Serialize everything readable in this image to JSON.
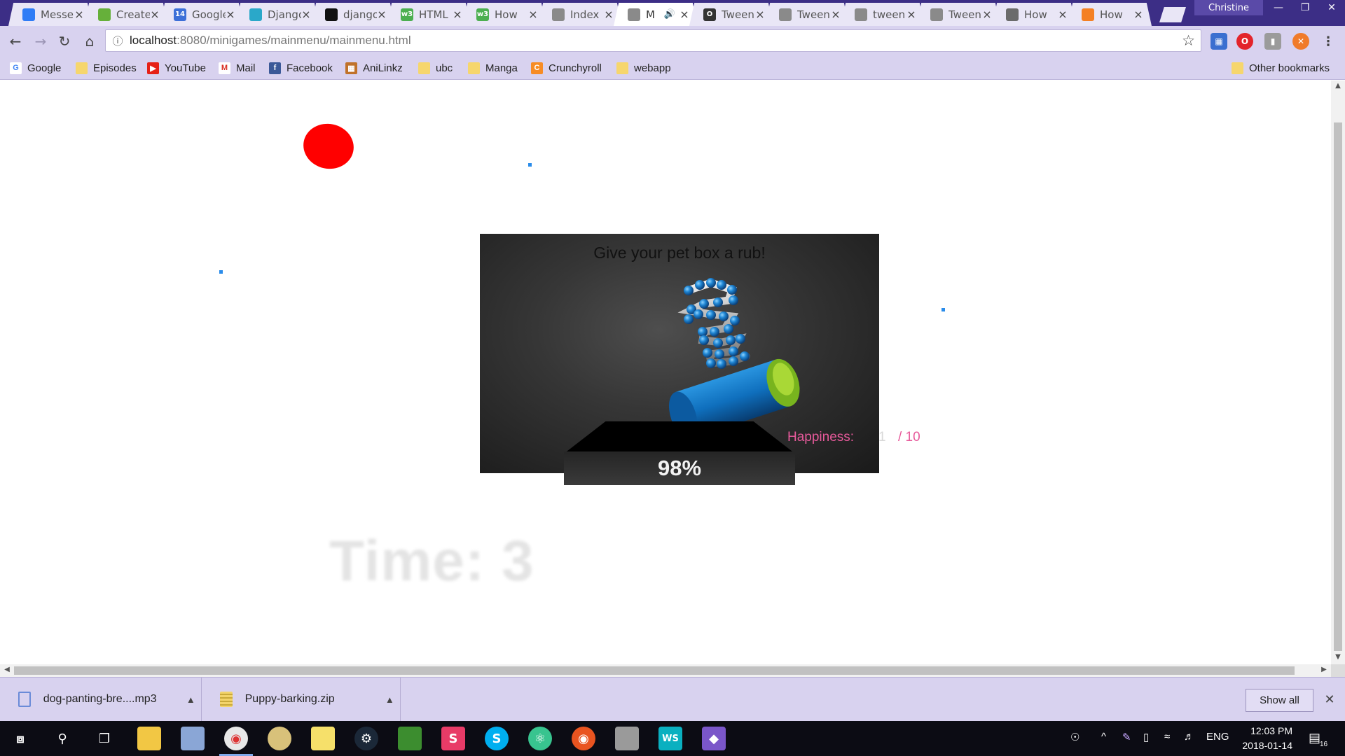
{
  "browser": {
    "profile_name": "Christine",
    "tabs": [
      {
        "title": "Messenger",
        "favicon": "messenger-icon",
        "color": "#2f7cf6"
      },
      {
        "title": "Create",
        "favicon": "leaf-icon",
        "color": "#66b03a"
      },
      {
        "title": "Google Calendar",
        "favicon": "calendar-icon",
        "color": "#3c6fd8",
        "favicon_text": "14"
      },
      {
        "title": "Django",
        "favicon": "django-icon",
        "color": "#2aa8c9"
      },
      {
        "title": "django",
        "favicon": "github-icon",
        "color": "#111111"
      },
      {
        "title": "HTML",
        "favicon": "w3schools-icon",
        "color": "#4caf50",
        "favicon_text": "w3"
      },
      {
        "title": "How",
        "favicon": "w3schools-icon",
        "color": "#4caf50",
        "favicon_text": "w3"
      },
      {
        "title": "Index",
        "favicon": "page-icon",
        "color": "#8a8a8a"
      },
      {
        "title": "M",
        "favicon": "page-icon",
        "color": "#8a8a8a",
        "active": true,
        "audio": true
      },
      {
        "title": "Tween",
        "favicon": "o-icon",
        "color": "#333333",
        "favicon_text": "O"
      },
      {
        "title": "Tween",
        "favicon": "page-icon",
        "color": "#8a8a8a"
      },
      {
        "title": "tween",
        "favicon": "page-icon",
        "color": "#8a8a8a"
      },
      {
        "title": "Tween",
        "favicon": "page-icon",
        "color": "#8a8a8a"
      },
      {
        "title": "How",
        "favicon": "atom-icon",
        "color": "#6b6b6b"
      },
      {
        "title": "How",
        "favicon": "stackoverflow-icon",
        "color": "#f48024"
      }
    ],
    "url_host": "localhost",
    "url_rest": ":8080/minigames/mainmenu/mainmenu.html",
    "bookmarks": [
      {
        "label": "Google",
        "icon": "google-icon"
      },
      {
        "label": "Episodes",
        "icon": "folder-icon"
      },
      {
        "label": "YouTube",
        "icon": "youtube-icon"
      },
      {
        "label": "Mail",
        "icon": "gmail-icon"
      },
      {
        "label": "Facebook",
        "icon": "facebook-icon"
      },
      {
        "label": "AniLinkz",
        "icon": "anilinkz-icon"
      },
      {
        "label": "ubc",
        "icon": "folder-icon"
      },
      {
        "label": "Manga",
        "icon": "folder-icon"
      },
      {
        "label": "Crunchyroll",
        "icon": "crunchyroll-icon"
      },
      {
        "label": "webapp",
        "icon": "folder-icon"
      }
    ],
    "other_bookmarks": "Other bookmarks"
  },
  "game": {
    "prompt": "Give your pet box a rub!",
    "percent": "98%",
    "happiness_label": "Happiness:",
    "happiness_value": "1",
    "happiness_max": "/ 10",
    "timer": "Time: 3"
  },
  "downloads": [
    {
      "filename": "dog-panting-bre....mp3",
      "icon": "audio-file-icon"
    },
    {
      "filename": "Puppy-barking.zip",
      "icon": "zip-file-icon"
    }
  ],
  "show_all_label": "Show all",
  "taskbar": {
    "language": "ENG",
    "time": "12:03 PM",
    "date": "2018-01-14",
    "notification_count": "16"
  }
}
